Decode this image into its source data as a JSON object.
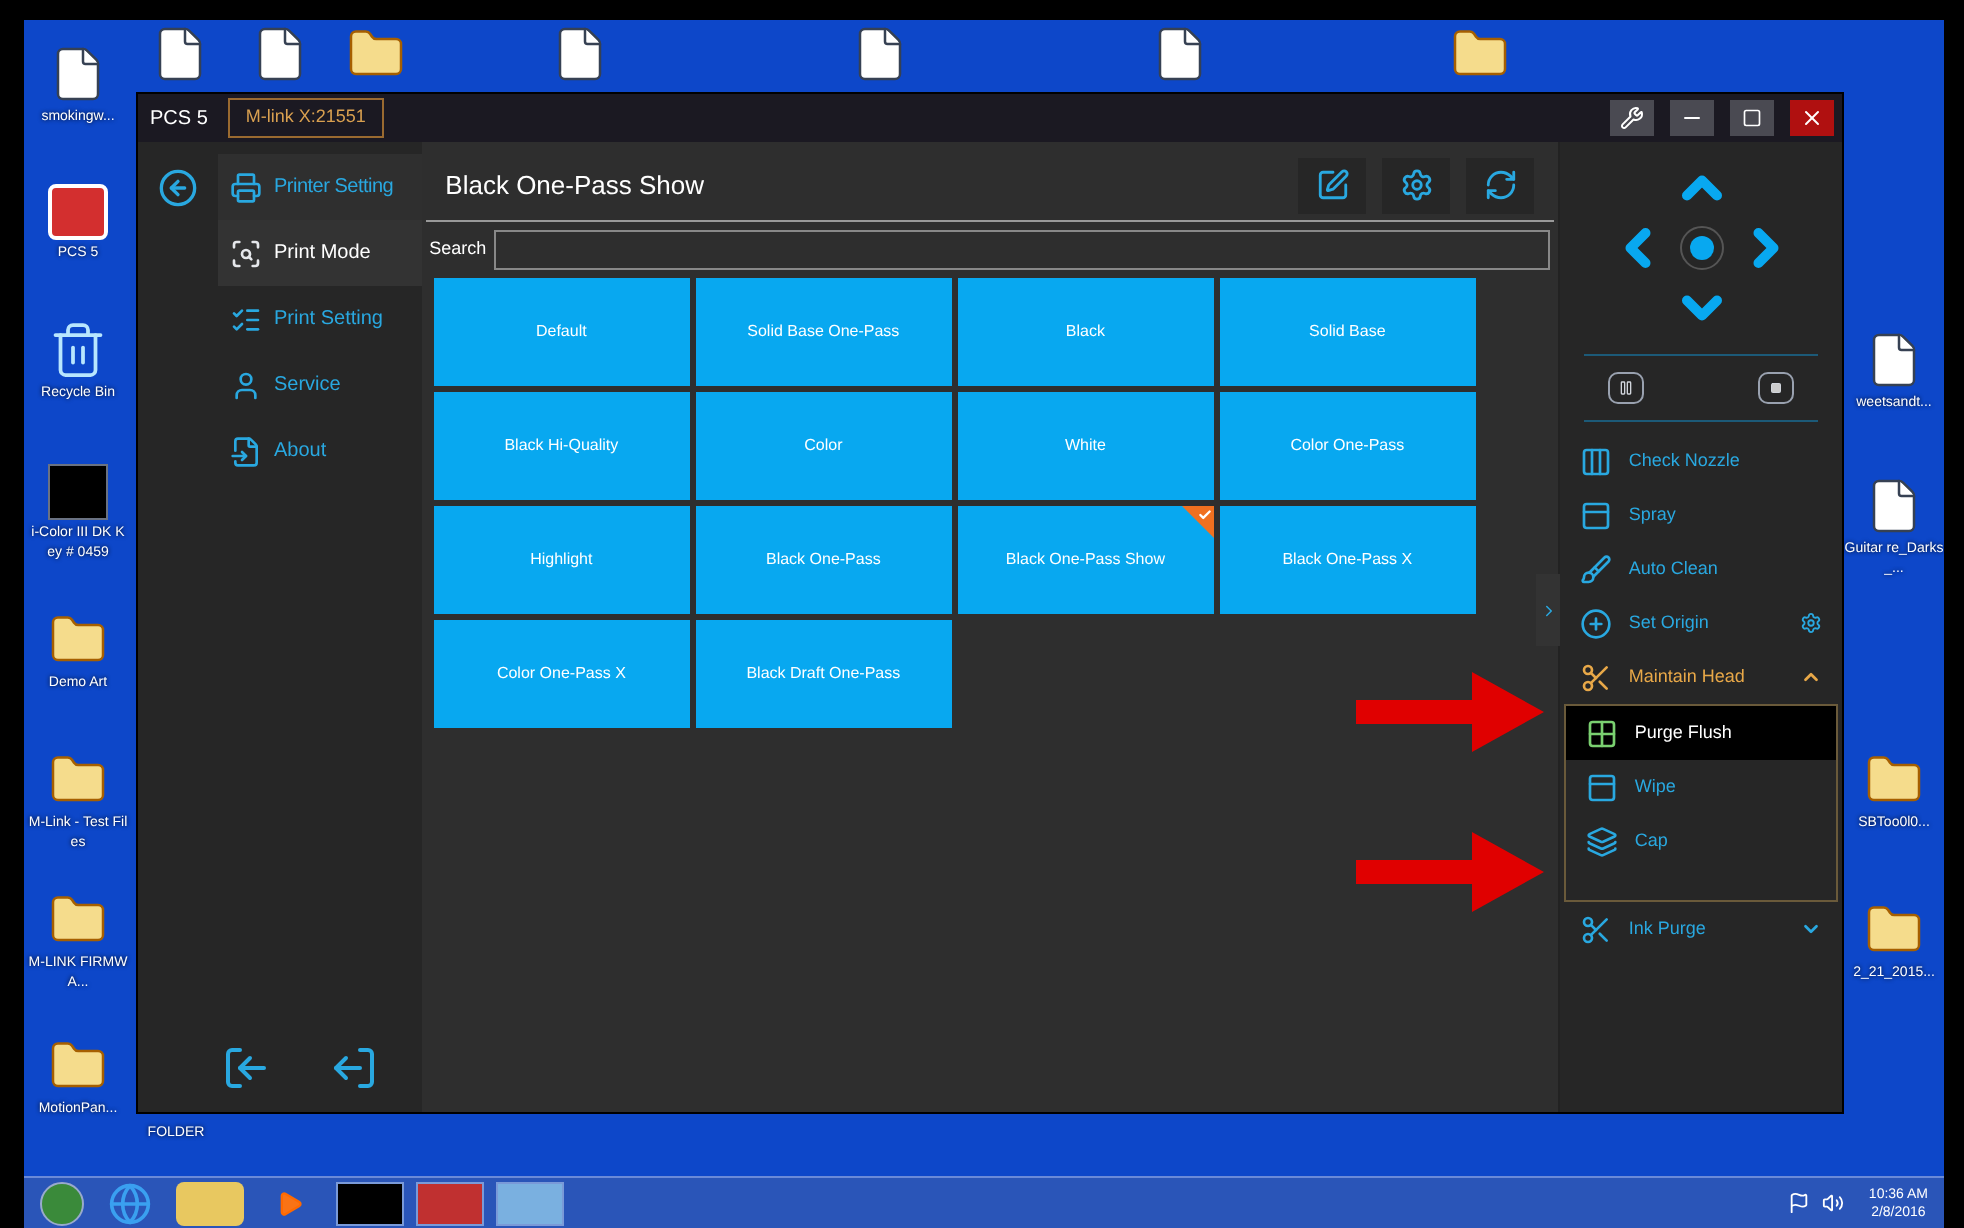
{
  "desktop_icons": [
    {
      "kind": "file",
      "label": "smokingw..."
    },
    {
      "kind": "app",
      "label": "PCS 5"
    },
    {
      "kind": "bin",
      "label": "Recycle Bin"
    },
    {
      "kind": "app2",
      "label": "i-Color III DK Key # 0459"
    },
    {
      "kind": "folder",
      "label": "Demo Art"
    },
    {
      "kind": "folder",
      "label": "M-Link - Test Files"
    },
    {
      "kind": "folder",
      "label": "M-LINK FIRMWA..."
    },
    {
      "kind": "folder",
      "label": "MotionPan..."
    },
    {
      "kind": "file"
    },
    {
      "kind": "file"
    },
    {
      "kind": "folder"
    },
    {
      "kind": "file"
    },
    {
      "kind": "file"
    },
    {
      "kind": "file"
    },
    {
      "kind": "folder"
    },
    {
      "kind": "file",
      "label": "weetsandt..."
    },
    {
      "kind": "file",
      "label": "Guitar re_Darks_..."
    },
    {
      "kind": "folder",
      "label": "SBToo0l0..."
    },
    {
      "kind": "folder",
      "label": "2_21_2015..."
    },
    {
      "kind": "label",
      "label": "FOLDER"
    }
  ],
  "window": {
    "title": "PCS 5",
    "connection": "M-link X:21551"
  },
  "sidebar": {
    "items": [
      {
        "kind": "header",
        "label": "Printer Setting",
        "selected": false
      },
      {
        "kind": "item",
        "label": "Print Mode",
        "selected": true
      },
      {
        "kind": "item",
        "label": "Print Setting",
        "selected": false
      },
      {
        "kind": "item",
        "label": "Service",
        "selected": false
      },
      {
        "kind": "item",
        "label": "About",
        "selected": false
      }
    ]
  },
  "main": {
    "title": "Black One-Pass Show",
    "search": {
      "label": "Search"
    },
    "modes": [
      {
        "label": "Default",
        "selected": false
      },
      {
        "label": "Solid Base One-Pass",
        "selected": false
      },
      {
        "label": "Black",
        "selected": false
      },
      {
        "label": "Solid Base",
        "selected": false
      },
      {
        "label": "Black Hi-Quality",
        "selected": false
      },
      {
        "label": "Color",
        "selected": false
      },
      {
        "label": "White",
        "selected": false
      },
      {
        "label": "Color One-Pass",
        "selected": false
      },
      {
        "label": "Highlight",
        "selected": false
      },
      {
        "label": "Black One-Pass",
        "selected": false
      },
      {
        "label": "Black One-Pass Show",
        "selected": true
      },
      {
        "label": "Black One-Pass X",
        "selected": false
      },
      {
        "label": "Color One-Pass X",
        "selected": false
      },
      {
        "label": "Black Draft One-Pass",
        "selected": false
      }
    ]
  },
  "actions": [
    {
      "kind": "action",
      "label": "Check Nozzle"
    },
    {
      "kind": "action",
      "label": "Spray"
    },
    {
      "kind": "action",
      "label": "Auto Clean"
    },
    {
      "kind": "action",
      "label": "Set Origin",
      "has_settings": true
    },
    {
      "kind": "group",
      "label": "Maintain Head",
      "expanded": true,
      "children": [
        {
          "label": "Purge Flush",
          "selected": true
        },
        {
          "label": "Wipe",
          "selected": false
        },
        {
          "label": "Cap",
          "selected": false
        }
      ]
    },
    {
      "kind": "group",
      "label": "Ink Purge",
      "expanded": false
    }
  ],
  "taskbar": {
    "time": "10:36 AM",
    "date": "2/8/2016"
  }
}
